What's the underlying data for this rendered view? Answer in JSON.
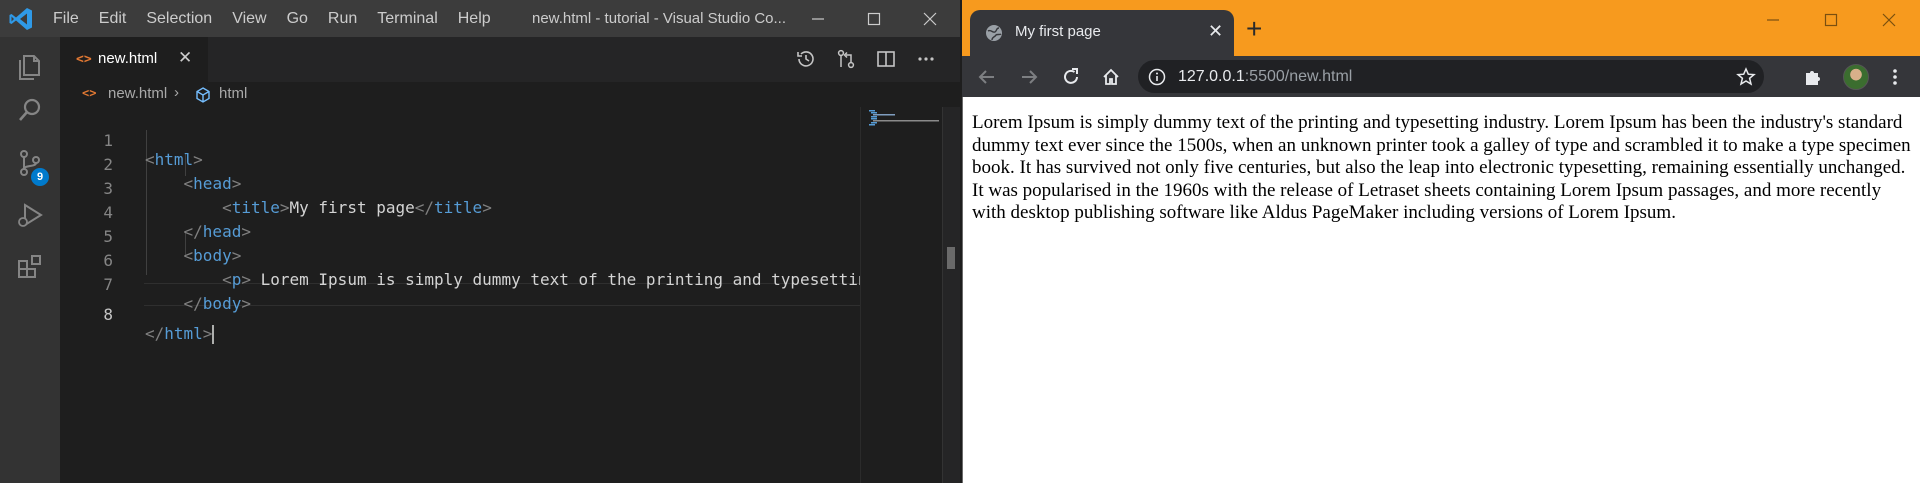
{
  "vscode": {
    "menu": [
      "File",
      "Edit",
      "Selection",
      "View",
      "Go",
      "Run",
      "Terminal",
      "Help"
    ],
    "window_title": "new.html - tutorial - Visual Studio Co...",
    "activity_badge": "9",
    "tab": {
      "label": "new.html",
      "close": "✕"
    },
    "breadcrumb": {
      "file": "new.html",
      "separator": "›",
      "symbol": "html"
    },
    "code_lines": [
      {
        "num": "1",
        "indent": "",
        "open": "<",
        "name": "html",
        "close": ">"
      },
      {
        "num": "2",
        "indent": "    ",
        "open": "<",
        "name": "head",
        "close": ">"
      },
      {
        "num": "3",
        "indent": "        ",
        "t1_open": "<",
        "t1_name": "title",
        "t1_close": ">",
        "text": "My first page",
        "t2_open": "</",
        "t2_name": "title",
        "t2_close": ">"
      },
      {
        "num": "4",
        "indent": "    ",
        "open": "</",
        "name": "head",
        "close": ">"
      },
      {
        "num": "5",
        "indent": "    ",
        "open": "<",
        "name": "body",
        "close": ">"
      },
      {
        "num": "6",
        "indent": "        ",
        "open": "<",
        "name": "p",
        "close": ">",
        "text": " Lorem Ipsum is simply dummy text of the printing and typesettin"
      },
      {
        "num": "7",
        "indent": "    ",
        "open": "</",
        "name": "body",
        "close": ">"
      },
      {
        "num": "8",
        "indent": "",
        "open": "</",
        "name": "html",
        "close": ">"
      }
    ]
  },
  "chrome": {
    "tab_title": "My first page",
    "tab_close": "✕",
    "new_tab": "+",
    "url_host": "127.0.0.1",
    "url_rest": ":5500/new.html",
    "page_text": "Lorem Ipsum is simply dummy text of the printing and typesetting industry. Lorem Ipsum has been the industry's standard dummy text ever since the 1500s, when an unknown printer took a galley of type and scrambled it to make a type specimen book. It has survived not only five centuries, but also the leap into electronic typesetting, remaining essentially unchanged. It was popularised in the 1960s with the release of Letraset sheets containing Lorem Ipsum passages, and more recently with desktop publishing software like Aldus PageMaker including versions of Lorem Ipsum."
  },
  "colors": {
    "vscode_accent": "#007acc",
    "chrome_frame": "#f79a1e",
    "html_tag": "#569cd6"
  },
  "icons": {
    "vscode_activity": [
      "explorer-icon",
      "search-icon",
      "source-control-icon",
      "run-debug-icon",
      "extensions-icon"
    ],
    "vscode_tab_actions": [
      "timeline-icon",
      "compare-changes-icon",
      "split-editor-icon",
      "more-actions-icon"
    ],
    "chrome_toolbar": [
      "back-icon",
      "forward-icon",
      "reload-icon",
      "home-icon",
      "site-info-icon",
      "bookmark-star-icon",
      "extensions-icon",
      "profile-avatar",
      "chrome-menu-icon"
    ]
  }
}
